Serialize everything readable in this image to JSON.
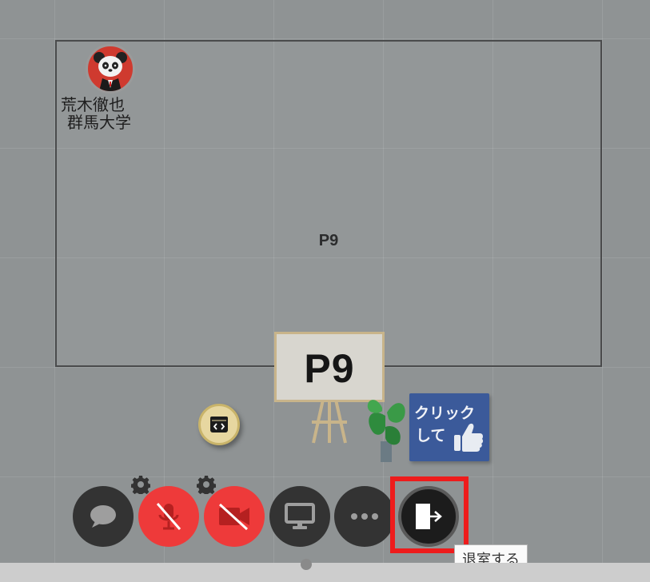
{
  "room": {
    "label": "P9"
  },
  "user": {
    "name": "荒木徹也",
    "organization": "群馬大学",
    "avatar_icon": "panda-icon",
    "avatar_color": "#cf3a2f"
  },
  "objects": {
    "signboard_text": "P9",
    "click_sign": {
      "line1": "クリック",
      "line2": "して",
      "icon": "thumbs-up-icon",
      "color": "#3b5a9a"
    },
    "embed_icon": "code-window-icon"
  },
  "controls": [
    {
      "name": "chat",
      "icon": "chat-bubble-icon",
      "state": "normal"
    },
    {
      "name": "microphone",
      "icon": "microphone-off-icon",
      "state": "muted",
      "has_settings": true
    },
    {
      "name": "camera",
      "icon": "camera-off-icon",
      "state": "off",
      "has_settings": true
    },
    {
      "name": "screen-share",
      "icon": "monitor-icon",
      "state": "normal"
    },
    {
      "name": "more",
      "icon": "more-dots-icon",
      "state": "normal"
    },
    {
      "name": "leave",
      "icon": "exit-door-icon",
      "state": "hover"
    }
  ],
  "tooltip": {
    "text": "退室する"
  },
  "colors": {
    "accent_red": "#ee3a3a",
    "highlight": "#ee1c1c",
    "button_dark": "#333333"
  }
}
